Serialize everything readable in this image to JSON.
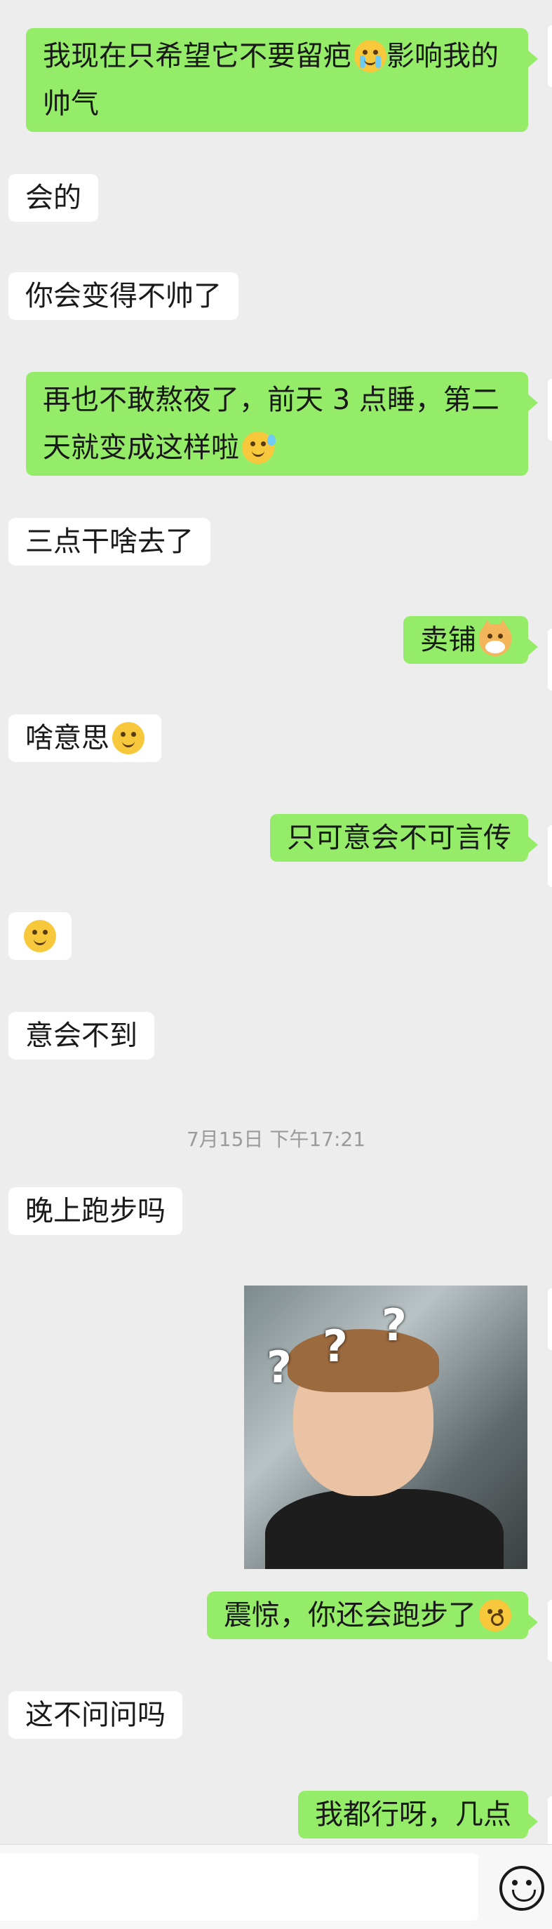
{
  "messages": [
    {
      "side": "right",
      "text": "我现在只希望它不要留疤",
      "emoji": "crying-emoji",
      "text2": "影响我的帅气"
    },
    {
      "side": "left",
      "text": "会的"
    },
    {
      "side": "left",
      "text": "你会变得不帅了"
    },
    {
      "side": "right",
      "text": "再也不敢熬夜了，前天 3 点睡，第二天就变成这样啦",
      "emoji": "sweat-emoji"
    },
    {
      "side": "left",
      "text": "三点干啥去了"
    },
    {
      "side": "right",
      "text": "卖铺",
      "emoji": "doge-emoji"
    },
    {
      "side": "left",
      "text": "啥意思",
      "emoji": "facepalm-emoji"
    },
    {
      "side": "right",
      "text": "只可意会不可言传"
    },
    {
      "side": "left",
      "text": "",
      "emoji": "facepalm-emoji"
    },
    {
      "side": "left",
      "text": "意会不到"
    },
    {
      "side": "left",
      "text": "晚上跑步吗"
    },
    {
      "side": "right",
      "text": "震惊，你还会跑步了",
      "emoji": "shocked-emoji"
    },
    {
      "side": "left",
      "text": "这不问问吗"
    },
    {
      "side": "right",
      "text": "我都行呀，几点"
    }
  ],
  "timestamp": "7月15日 下午17:21",
  "sticker": {
    "marks": [
      "?",
      "?",
      "?"
    ]
  },
  "colors": {
    "background": "#ededed",
    "sent_bubble": "#95ec69",
    "received_bubble": "#ffffff"
  },
  "input": {
    "emoji_button_icon": "smiley-icon"
  }
}
